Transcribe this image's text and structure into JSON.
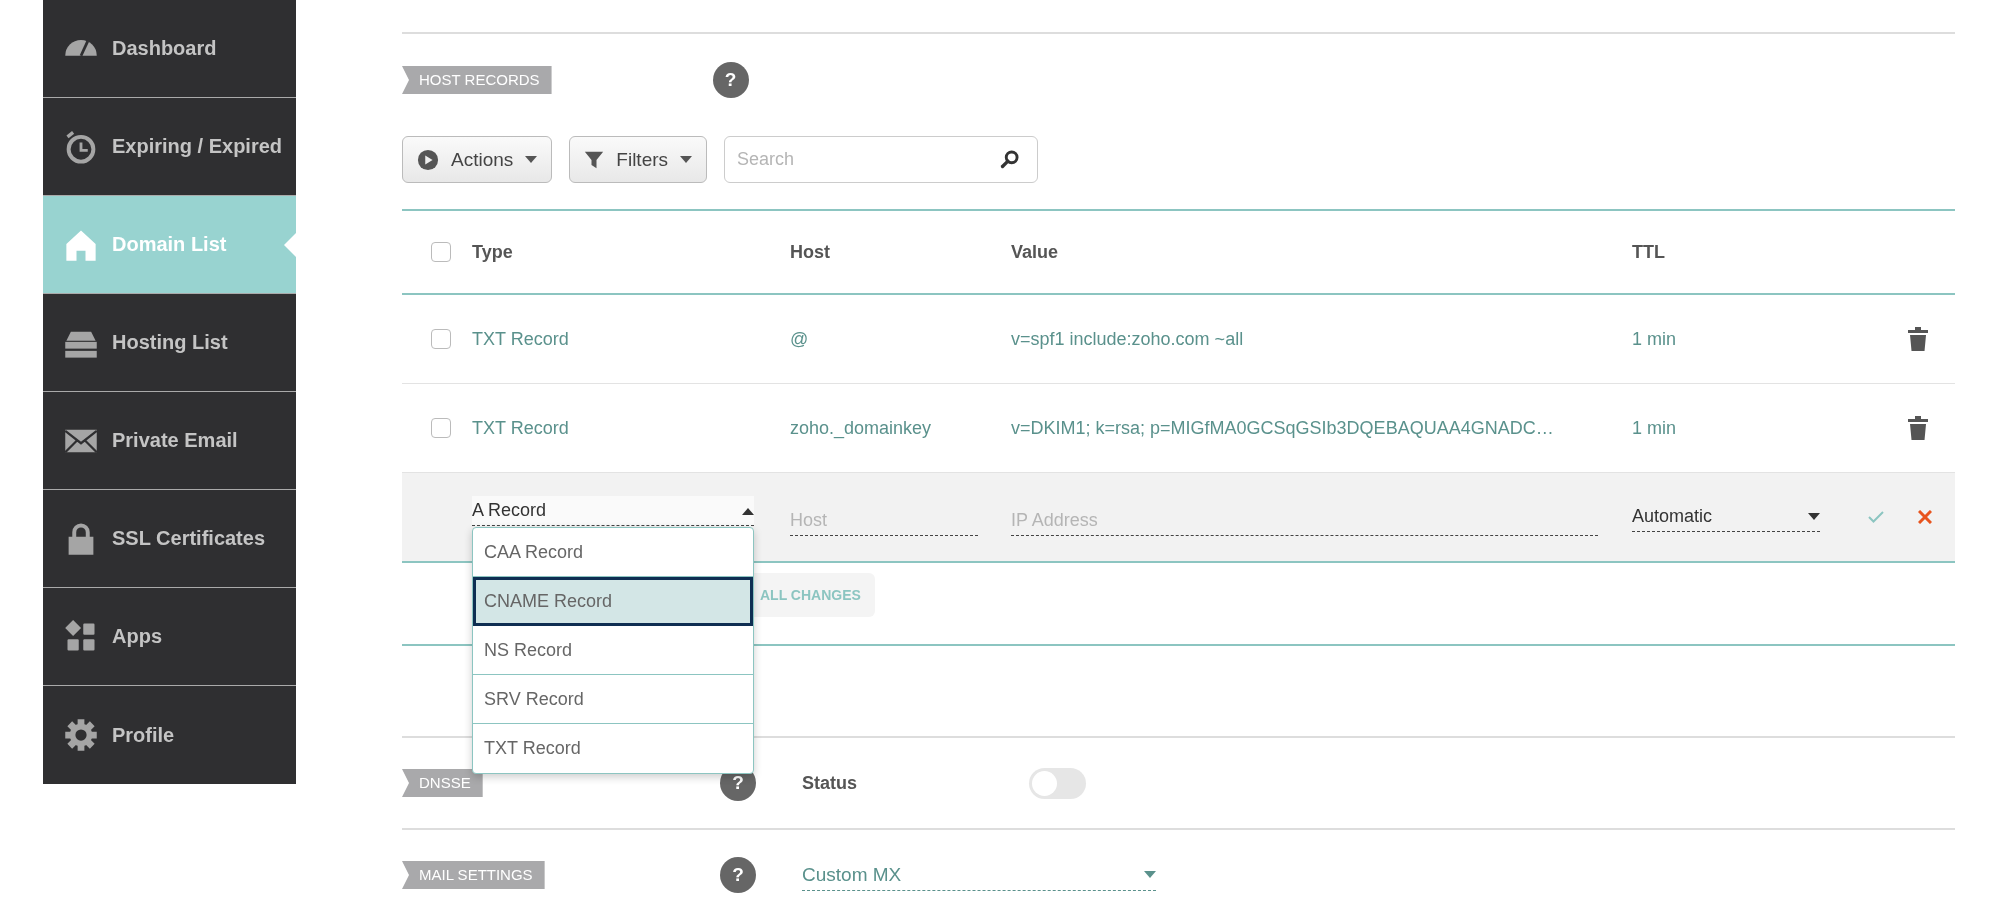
{
  "sidebar": {
    "items": [
      {
        "label": "Dashboard",
        "kind": "gauge",
        "selected": false
      },
      {
        "label": "Expiring / Expired",
        "kind": "timer",
        "selected": false
      },
      {
        "label": "Domain List",
        "kind": "house",
        "selected": true
      },
      {
        "label": "Hosting List",
        "kind": "server",
        "selected": false
      },
      {
        "label": "Private Email",
        "kind": "envelope",
        "selected": false
      },
      {
        "label": "SSL Certificates",
        "kind": "lock",
        "selected": false
      },
      {
        "label": "Apps",
        "kind": "apps",
        "selected": false
      },
      {
        "label": "Profile",
        "kind": "gear",
        "selected": false
      }
    ]
  },
  "host_records": {
    "badge": "HOST RECORDS",
    "help": "?",
    "toolbar": {
      "actions": "Actions",
      "filters": "Filters",
      "search_placeholder": "Search"
    },
    "table": {
      "select_all_checked": false,
      "columns": [
        "Type",
        "Host",
        "Value",
        "TTL"
      ],
      "rows": [
        {
          "checked": false,
          "type": "TXT Record",
          "host": "@",
          "value": "v=spf1 include:zoho.com ~all",
          "ttl": "1 min"
        },
        {
          "checked": false,
          "type": "TXT Record",
          "host": "zoho._domainkey",
          "value": "v=DKIM1; k=rsa; p=MIGfMA0GCSqGSIb3DQEBAQUAA4GNADC…",
          "ttl": "1 min"
        }
      ],
      "edit_row": {
        "type_value": "A Record",
        "host_placeholder": "Host",
        "value_placeholder": "IP Address",
        "ttl_value": "Automatic"
      },
      "type_dropdown": {
        "expanded": true,
        "options": [
          {
            "label": "CAA Record",
            "selected": false
          },
          {
            "label": "CNAME Record",
            "selected": true
          },
          {
            "label": "NS Record",
            "selected": false
          },
          {
            "label": "SRV Record",
            "selected": false
          },
          {
            "label": "TXT Record",
            "selected": false
          }
        ]
      }
    },
    "save_button": "ALL CHANGES"
  },
  "dnssec": {
    "badge": "DNSSE",
    "help": "?",
    "status_label": "Status",
    "on": false
  },
  "mail_settings": {
    "badge": "MAIL SETTINGS",
    "help": "?",
    "value": "Custom MX"
  }
}
